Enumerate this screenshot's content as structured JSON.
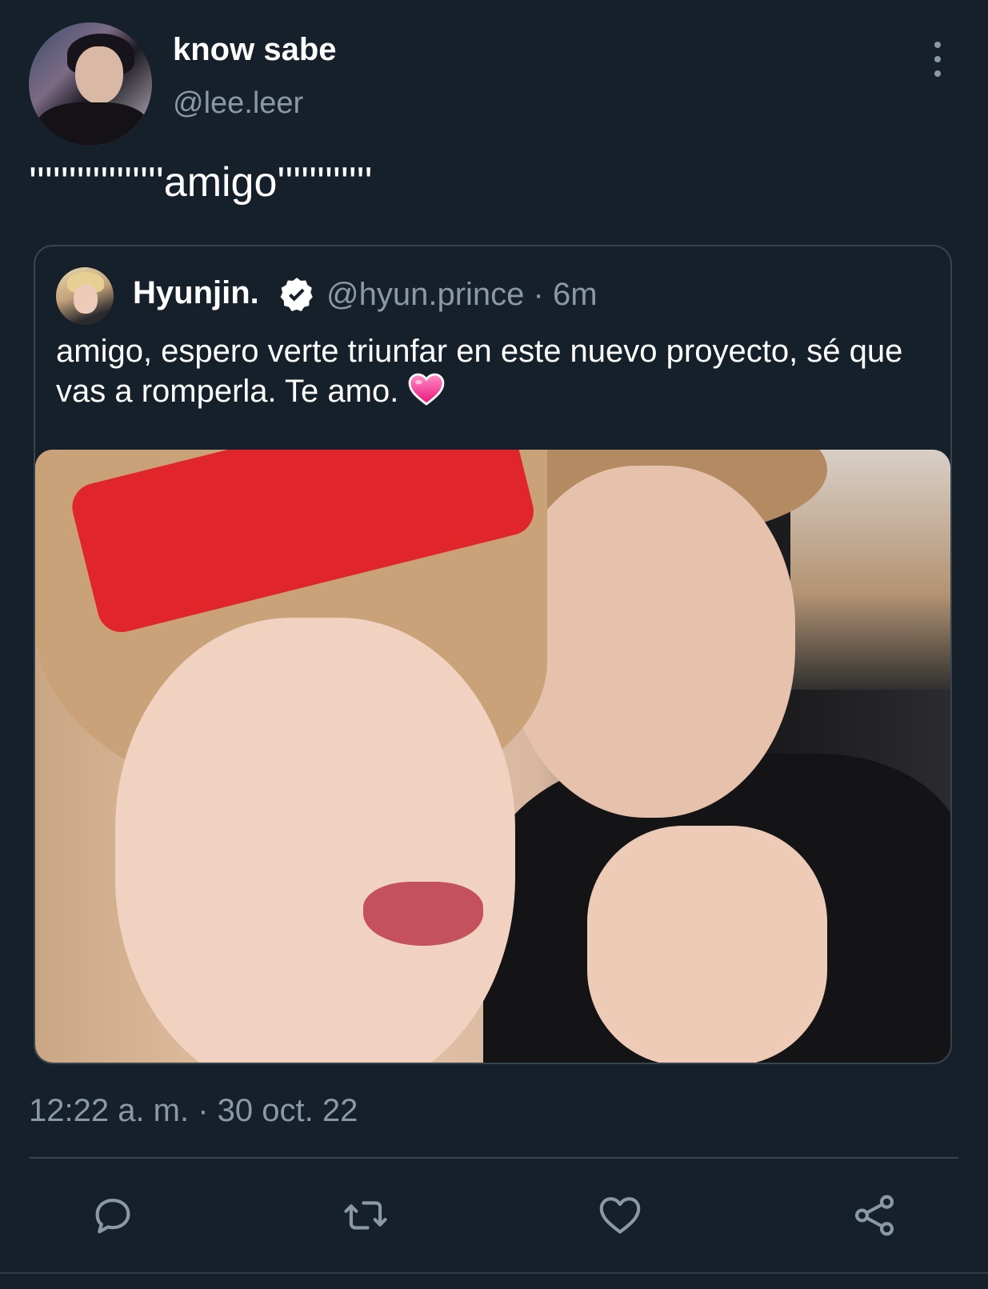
{
  "author": {
    "display_name": "know sabe",
    "handle": "@lee.leer"
  },
  "tweet": {
    "text": "'''''''''''''''''amigo''''''''''''"
  },
  "quoted_tweet": {
    "display_name": "Hyunjin.",
    "handle_and_time": "@hyun.prince · 6m",
    "text": "amigo, espero verte triunfar en este nuevo proyecto, sé que vas a romperla. Te amo.",
    "emoji": "heart-emoji"
  },
  "timestamp": "12:22 a. m. · 30 oct. 22",
  "actions": [
    {
      "name": "reply",
      "icon": "reply-icon"
    },
    {
      "name": "retweet",
      "icon": "retweet-icon"
    },
    {
      "name": "like",
      "icon": "heart-icon"
    },
    {
      "name": "share",
      "icon": "share-icon"
    }
  ],
  "colors": {
    "background": "#15202b",
    "primary_text": "#ffffff",
    "secondary_text": "#8b98a5",
    "border": "#38444d"
  }
}
